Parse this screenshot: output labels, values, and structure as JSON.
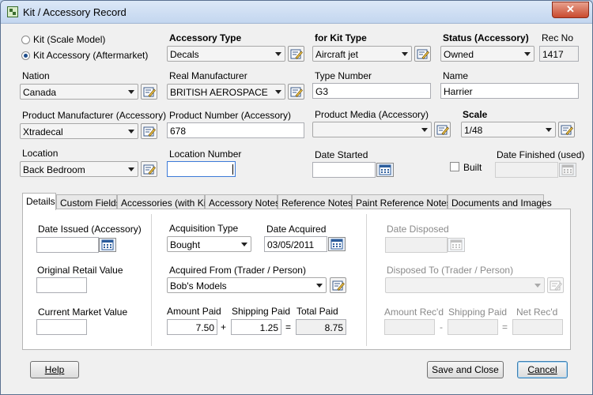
{
  "window": {
    "title": "Kit / Accessory Record",
    "close_glyph": "✕"
  },
  "record_type": {
    "option_scale_model": "Kit (Scale Model)",
    "option_aftermarket": "Kit Accessory (Aftermarket)",
    "selected": "Kit Accessory (Aftermarket)"
  },
  "header": {
    "accessory_type_label": "Accessory Type",
    "accessory_type_value": "Decals",
    "for_kit_type_label": "for Kit Type",
    "for_kit_type_value": "Aircraft jet",
    "status_label": "Status (Accessory)",
    "status_value": "Owned",
    "rec_no_label": "Rec No",
    "rec_no_value": "1417"
  },
  "row2": {
    "nation_label": "Nation",
    "nation_value": "Canada",
    "real_manufacturer_label": "Real Manufacturer",
    "real_manufacturer_value": "BRITISH AEROSPACE",
    "type_number_label": "Type Number",
    "type_number_value": "G3",
    "name_label": "Name",
    "name_value": "Harrier"
  },
  "row3": {
    "product_manufacturer_label": "Product Manufacturer (Accessory)",
    "product_manufacturer_value": "Xtradecal",
    "product_number_label": "Product Number (Accessory)",
    "product_number_value": "678",
    "product_media_label": "Product Media (Accessory)",
    "product_media_value": "",
    "scale_label": "Scale",
    "scale_value": "1/48"
  },
  "row4": {
    "location_label": "Location",
    "location_value": "Back Bedroom",
    "location_number_label": "Location Number",
    "location_number_value": "",
    "date_started_label": "Date Started",
    "date_started_value": "",
    "built_label": "Built",
    "date_finished_label": "Date Finished (used)",
    "date_finished_value": ""
  },
  "tabs": [
    {
      "label": "Details",
      "active": true
    },
    {
      "label": "Custom Fields"
    },
    {
      "label": "Accessories (with Kit)"
    },
    {
      "label": "Accessory Notes"
    },
    {
      "label": "Reference Notes"
    },
    {
      "label": "Paint Reference Notes"
    },
    {
      "label": "Documents and Images"
    }
  ],
  "details": {
    "date_issued_label": "Date Issued (Accessory)",
    "date_issued_value": "",
    "original_retail_label": "Original Retail Value",
    "original_retail_value": "",
    "current_market_label": "Current Market Value",
    "current_market_value": "",
    "acquisition_type_label": "Acquisition Type",
    "acquisition_type_value": "Bought",
    "date_acquired_label": "Date Acquired",
    "date_acquired_value": "03/05/2011",
    "acquired_from_label": "Acquired From (Trader / Person)",
    "acquired_from_value": "Bob's Models",
    "amount_paid_label": "Amount Paid",
    "amount_paid_value": "7.50",
    "shipping_paid_label": "Shipping Paid",
    "shipping_paid_value": "1.25",
    "total_paid_label": "Total Paid",
    "total_paid_value": "8.75",
    "plus_sign": "+",
    "equals_sign": "=",
    "minus_sign": "-",
    "date_disposed_label": "Date Disposed",
    "date_disposed_value": "",
    "disposed_to_label": "Disposed To (Trader / Person)",
    "disposed_to_value": "",
    "amount_recd_label": "Amount Rec'd",
    "amount_recd_value": "",
    "shipping_paid2_label": "Shipping Paid",
    "shipping_paid2_value": "",
    "net_recd_label": "Net Rec'd",
    "net_recd_value": ""
  },
  "buttons": {
    "help": "Help",
    "save_close": "Save and Close",
    "cancel": "Cancel"
  }
}
